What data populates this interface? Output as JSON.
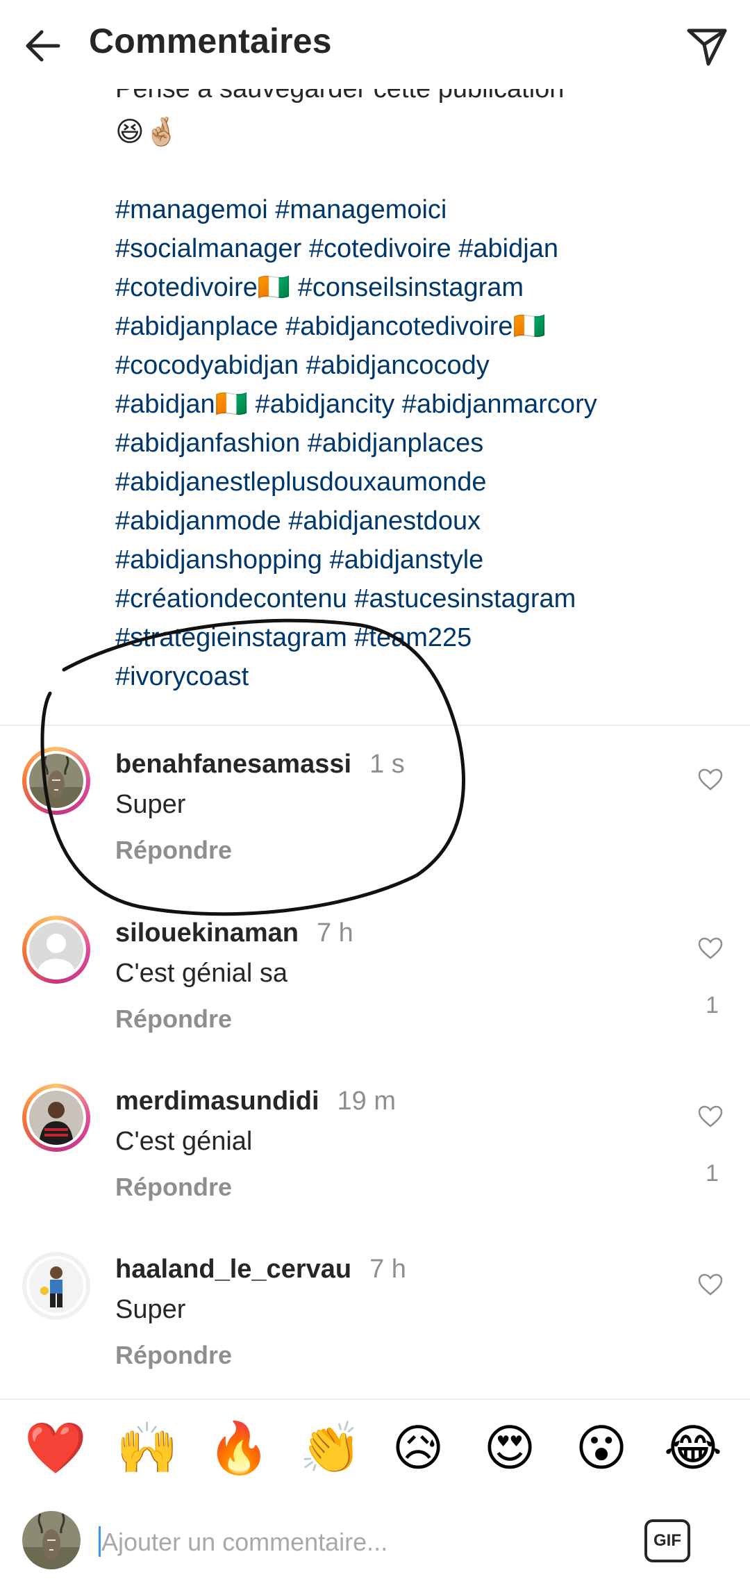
{
  "header": {
    "title": "Commentaires",
    "back_icon": "arrow-left-icon",
    "send_icon": "paper-plane-icon"
  },
  "caption": {
    "line1": "Pense à sauvegarder cette publication",
    "emojis": "😆🤞🏼",
    "hashtag_lines": [
      "#managemoi #managemoici",
      "#socialmanager #cotedivoire #abidjan",
      "#cotedivoire🇨🇮 #conseilsinstagram",
      "#abidjanplace #abidjancotedivoire🇨🇮",
      "#cocodyabidjan #abidjancocody",
      "#abidjan🇨🇮 #abidjancity #abidjanmarcory",
      "#abidjanfashion #abidjanplaces",
      "#abidjanestleplusdouxaumonde",
      "#abidjanmode #abidjanestdoux",
      "#abidjanshopping #abidjanstyle",
      "#créationdecontenu #astucesinstagram",
      "#strategieinstagram #team225",
      "#ivorycoast"
    ]
  },
  "comments": [
    {
      "user": "benahfanesamassi",
      "time": "1 s",
      "text": "Super",
      "reply": "Répondre",
      "likes": ""
    },
    {
      "user": "silouekinaman",
      "time": "7 h",
      "text": "C'est génial sa",
      "reply": "Répondre",
      "likes": "1"
    },
    {
      "user": "merdimasundidi",
      "time": "19 m",
      "text": "C'est génial",
      "reply": "Répondre",
      "likes": "1"
    },
    {
      "user": "haaland_le_cervau",
      "time": "7 h",
      "text": "Super",
      "reply": "Répondre",
      "likes": ""
    }
  ],
  "emoji_bar": [
    "❤️",
    "🙌",
    "🔥",
    "👏",
    "😥",
    "😍",
    "😮",
    "😂"
  ],
  "composer": {
    "placeholder": "Ajouter un commentaire...",
    "gif_label": "GIF"
  },
  "colors": {
    "hashtag": "#00376b",
    "muted": "#8e8e8e",
    "text": "#262626",
    "scribble": "#111111"
  }
}
